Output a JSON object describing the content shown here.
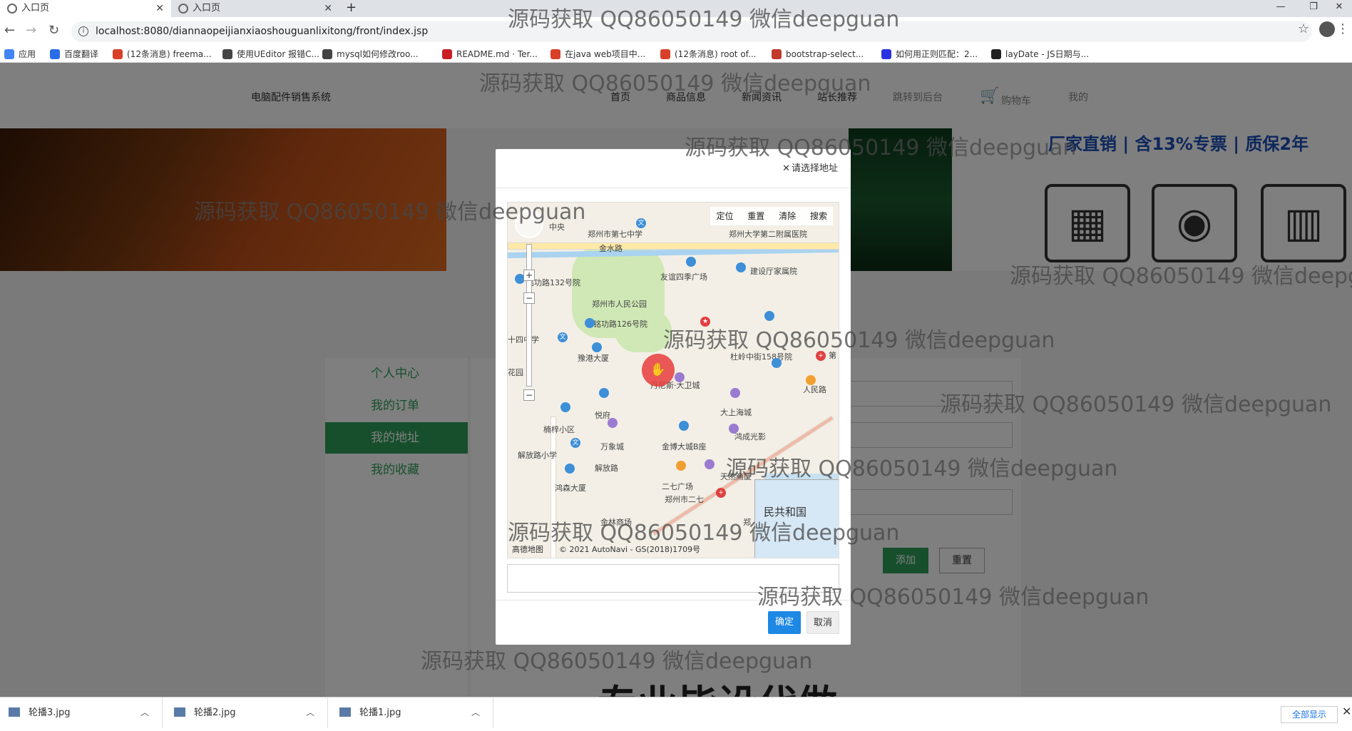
{
  "browser": {
    "tabs": [
      {
        "title": "入口页"
      },
      {
        "title": "入口页"
      }
    ],
    "url": "localhost:8080/diannaopeijianxiaoshouguanlixitong/front/index.jsp",
    "bookmarks": [
      {
        "label": "应用",
        "color": "#4285f4"
      },
      {
        "label": "百度翻译",
        "color": "#2b6de8"
      },
      {
        "label": "(12条消息) freema...",
        "color": "#d9402a"
      },
      {
        "label": "使用UEditor 报错C...",
        "color": "#444444"
      },
      {
        "label": "mysql如何修改roo...",
        "color": "#444444"
      },
      {
        "label": "README.md · Ter...",
        "color": "#c71d23"
      },
      {
        "label": "在java web项目中...",
        "color": "#d9402a"
      },
      {
        "label": "(12条消息) root of...",
        "color": "#d9402a"
      },
      {
        "label": "bootstrap-select...",
        "color": "#c0392b"
      },
      {
        "label": "如何用正则匹配：2...",
        "color": "#2932e1"
      },
      {
        "label": "layDate - JS日期与...",
        "color": "#222222"
      }
    ]
  },
  "site": {
    "title": "电脑配件销售系统",
    "nav": [
      "首页",
      "商品信息",
      "新闻资讯",
      "站长推荐",
      "跳转到后台",
      "购物车",
      "我的"
    ]
  },
  "banner": {
    "promo": "厂家直销 | 含13%专票 | 质保2年"
  },
  "sidebar": {
    "items": [
      {
        "label": "个人中心",
        "active": false
      },
      {
        "label": "我的订单",
        "active": false
      },
      {
        "label": "我的地址",
        "active": true
      },
      {
        "label": "我的收藏",
        "active": false
      }
    ]
  },
  "form": {
    "add_label": "添加",
    "reset_label": "重置"
  },
  "modal": {
    "title": "请选择地址",
    "toolbar": [
      "定位",
      "重置",
      "清除",
      "搜索"
    ],
    "ok_label": "确定",
    "cancel_label": "取消",
    "address_value": ""
  },
  "map": {
    "labels": [
      "中央",
      "郑州市第七中学",
      "金水路",
      "郑州大学第二附属医院",
      "友谊四季广场",
      "建设厅家属院",
      "铭功路132号院",
      "郑州市人民公园",
      "铭功路126号院",
      "豫港大厦",
      "杜岭中街158号院",
      "第",
      "人民路",
      "丹尼斯·大卫城",
      "大上海城",
      "悦府",
      "楠梓小区",
      "万象城",
      "金博大城B座",
      "鸿成光影",
      "解放路小学",
      "解放路",
      "二七广场",
      "天然商厦",
      "鸿森大厦",
      "郑州市二七",
      "金林商场",
      "郑",
      "十四中学",
      "花园"
    ],
    "mini_label": "民共和国",
    "logo": "高德地图",
    "copyright": "© 2021 AutoNavi - GS(2018)1709号"
  },
  "watermark": "源码获取 QQ86050149 微信deepguan",
  "caption": "专业毕设代做",
  "downloads": {
    "items": [
      "轮播3.jpg",
      "轮播2.jpg",
      "轮播1.jpg"
    ],
    "show_all": "全部显示"
  }
}
